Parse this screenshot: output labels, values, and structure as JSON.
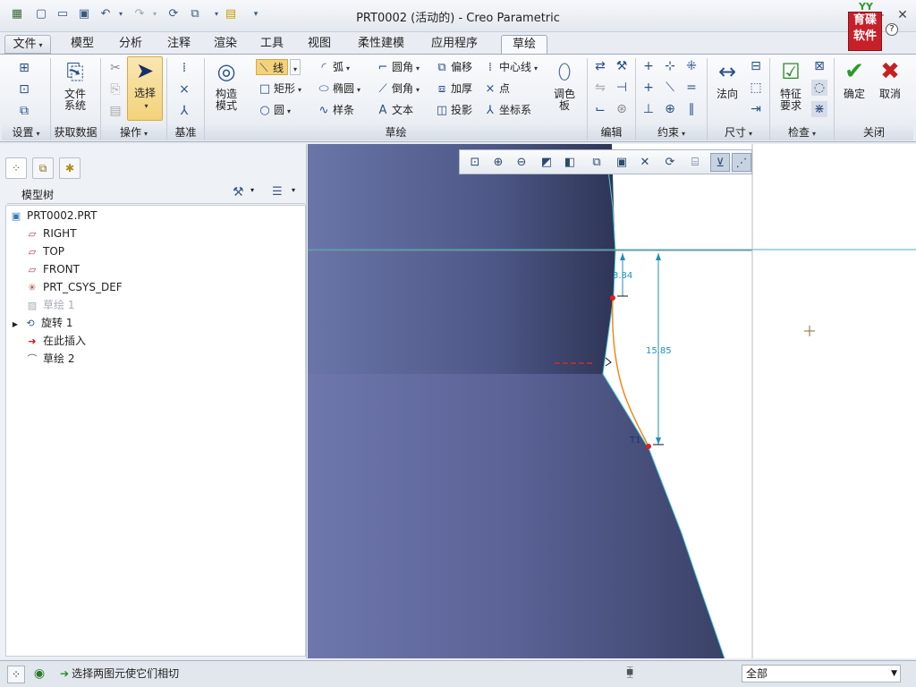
{
  "window": {
    "title": "PRT0002 (活动的) - Creo Parametric",
    "logo_text": "育碟软件",
    "logo_top": "YY"
  },
  "quick_access": [
    "new-icon",
    "open-icon",
    "save-icon",
    "undo-icon",
    "redo-icon",
    "regenerate-icon",
    "windows-icon",
    "close-window-icon",
    "customize-icon"
  ],
  "tabs": [
    {
      "label": "文件",
      "caret": "▾"
    },
    {
      "label": "模型"
    },
    {
      "label": "分析"
    },
    {
      "label": "注释"
    },
    {
      "label": "渲染"
    },
    {
      "label": "工具"
    },
    {
      "label": "视图"
    },
    {
      "label": "柔性建模"
    },
    {
      "label": "应用程序"
    },
    {
      "label": "草绘"
    }
  ],
  "ribbon": {
    "file_system": "文件\n系统",
    "select": "选择",
    "construction_mode": "构造\n模式",
    "sketch_items": {
      "line": "线",
      "rectangle": "矩形",
      "circle": "圆",
      "arc": "弧",
      "ellipse": "椭圆",
      "spline": "样条",
      "fillet": "圆角",
      "chamfer": "倒角",
      "text": "文本",
      "offset": "偏移",
      "thicken": "加厚",
      "project": "投影",
      "centerline": "中心线",
      "point": "点",
      "coord_sys": "坐标系"
    },
    "palette": "调色\n板",
    "normal": "法向",
    "feature_req": "特征\n要求",
    "ok": "确定",
    "cancel": "取消",
    "groups": [
      "设置",
      "获取数据",
      "操作",
      "基准",
      "草绘",
      "编辑",
      "约束",
      "尺寸",
      "检查",
      "关闭"
    ]
  },
  "model_tree": {
    "title": "模型树",
    "items": [
      {
        "label": "PRT0002.PRT",
        "icon": "part-icon"
      },
      {
        "label": "RIGHT",
        "icon": "datum-plane-icon"
      },
      {
        "label": "TOP",
        "icon": "datum-plane-icon"
      },
      {
        "label": "FRONT",
        "icon": "datum-plane-icon"
      },
      {
        "label": "PRT_CSYS_DEF",
        "icon": "csys-icon"
      },
      {
        "label": "草绘 1",
        "icon": "sketch-icon",
        "dim": true
      },
      {
        "label": "旋转 1",
        "icon": "revolve-icon"
      },
      {
        "label": "在此插入",
        "icon": "insert-arrow-icon"
      },
      {
        "label": "草绘 2",
        "icon": "sketch-icon"
      }
    ]
  },
  "canvas": {
    "dim_top": "3.84",
    "dim_height": "15.85",
    "tangent_label": "T1"
  },
  "status": {
    "message": "选择两图元使它们相切",
    "filter": "全部"
  },
  "colors": {
    "model_shade": "#5a6898",
    "sketch_curve": "#f08a1a",
    "dimension": "#1e8fbf",
    "ok_green": "#2a9a2a",
    "cancel_red": "#c62020"
  }
}
